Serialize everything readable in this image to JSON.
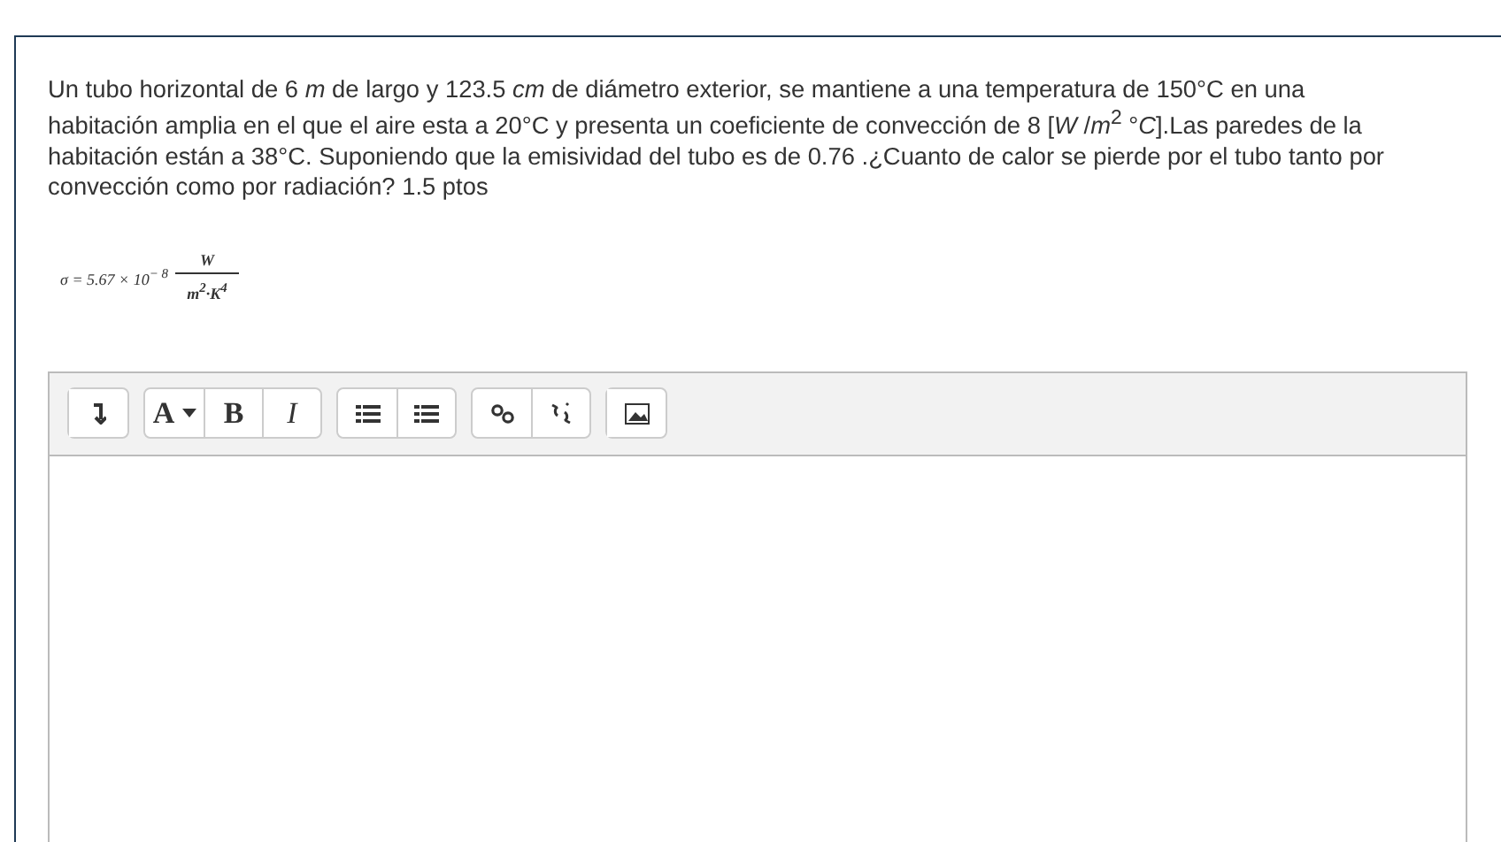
{
  "question": {
    "text": "Un tubo horizontal de 6 *m*  de largo y 123.5 *cm* de diámetro exterior, se mantiene a una temperatura de 150°C en una habitación amplia en el que el aire esta a 20°C y presenta un coeficiente de convección de 8 [*W* /*m*$^{2}$ °*C*].Las paredes de la habitación están a 38°C. Suponiendo que la emisividad del tubo es de 0.76 .¿Cuanto de calor se pierde por el tubo tanto por convección como por radiación? 1.5 ptos"
  },
  "formula": {
    "lhs": "σ = 5.67 × 10$^{− 8}$",
    "numerator": "W",
    "denominator": "m$^{2}$·K$^{4}$"
  },
  "toolbar": [
    [
      {
        "kind": "toggle"
      }
    ],
    [
      {
        "kind": "font",
        "label": "A"
      },
      {
        "kind": "bold",
        "label": "B"
      },
      {
        "kind": "italic",
        "label": "I"
      }
    ],
    [
      {
        "kind": "bullets"
      },
      {
        "kind": "numbers"
      }
    ],
    [
      {
        "kind": "link"
      },
      {
        "kind": "unlink"
      }
    ],
    [
      {
        "kind": "image"
      }
    ]
  ]
}
